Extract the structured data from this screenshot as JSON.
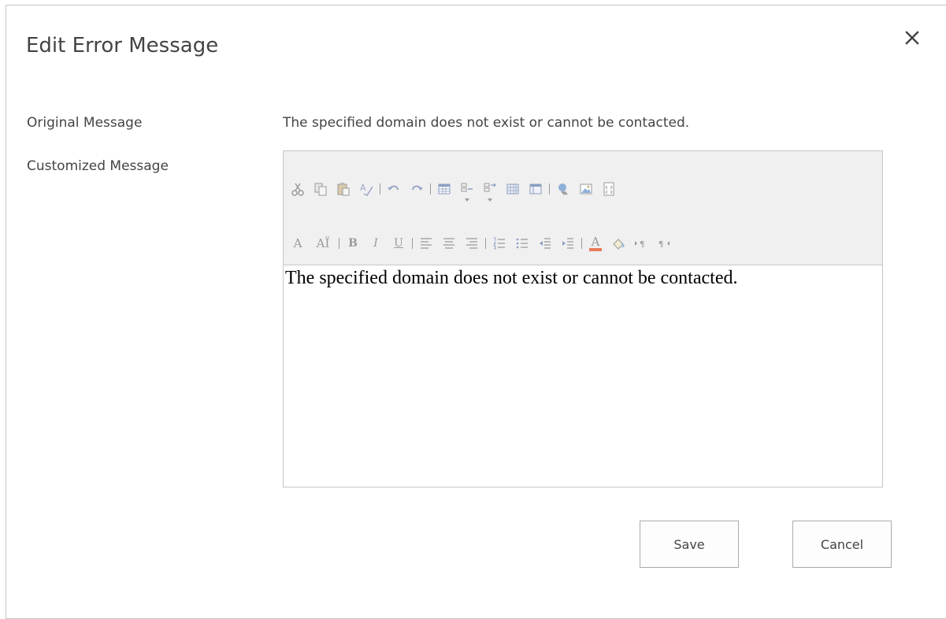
{
  "dialog": {
    "title": "Edit Error Message",
    "close_icon": "close-icon"
  },
  "form": {
    "original_label": "Original Message",
    "original_value": "The specified domain does not exist or cannot be contacted.",
    "customized_label": "Customized Message",
    "customized_value": "The specified domain does not exist or cannot be contacted."
  },
  "toolbar": {
    "row1_icons": [
      "cut-icon",
      "copy-icon",
      "paste-icon",
      "spelling-icon",
      "undo-icon",
      "redo-icon",
      "insert-table-icon",
      "insert-row-icon",
      "insert-column-icon",
      "table-properties-icon",
      "table-layout-icon",
      "link-icon",
      "image-icon",
      "html-source-icon"
    ],
    "row2_icons": [
      "font-icon",
      "font-size-icon",
      "bold-icon",
      "italic-icon",
      "underline-icon",
      "align-left-icon",
      "align-center-icon",
      "align-right-icon",
      "numbered-list-icon",
      "bulleted-list-icon",
      "decrease-indent-icon",
      "increase-indent-icon",
      "font-color-icon",
      "highlight-icon",
      "ltr-icon",
      "rtl-icon"
    ],
    "glyphs": {
      "font": "A",
      "font_size": "AÏ",
      "bold": "B",
      "italic": "I",
      "underline": "U",
      "font_color": "A"
    },
    "icon_color": "#9a9a9a",
    "font_color_bar": "#e87a5a"
  },
  "buttons": {
    "save": "Save",
    "cancel": "Cancel"
  }
}
